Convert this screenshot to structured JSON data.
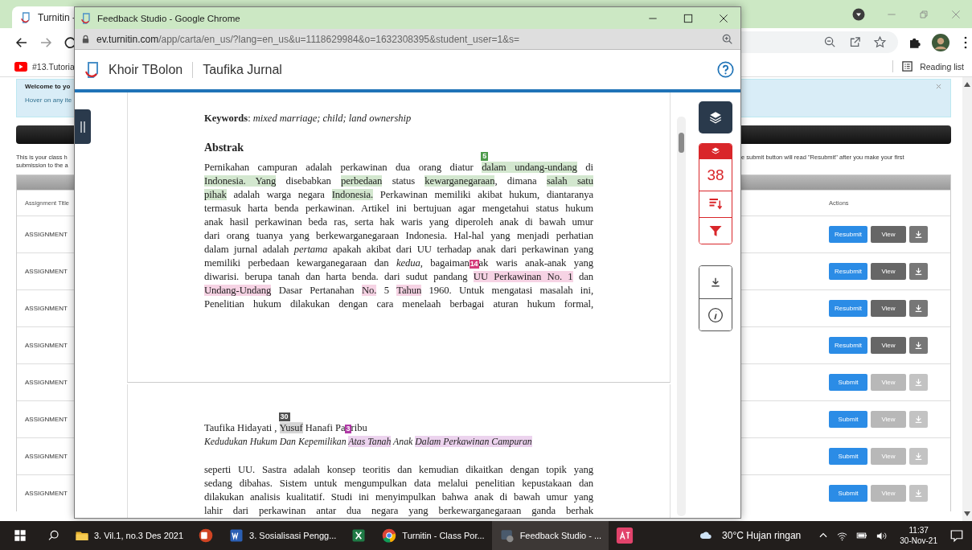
{
  "browser": {
    "tab": {
      "title": "Turnitin -"
    },
    "bookmark": {
      "label": "#13.Tutoria"
    },
    "reading_list": {
      "label": "Reading list"
    },
    "notice": {
      "title": "Welcome to yo",
      "text": "Hover on any ite"
    },
    "intro": {
      "left": [
        "This is your class h",
        "submission to the a"
      ],
      "right": "e submit button will read \"Resubmit\" after you make your first"
    },
    "table": {
      "columns": [
        "Assignment Title",
        "Actions"
      ],
      "rows": [
        {
          "title": "ASSIGNMENT",
          "action": "Resubmit",
          "view": "View",
          "disabled": false
        },
        {
          "title": "ASSIGNMENT",
          "action": "Resubmit",
          "view": "View",
          "disabled": false
        },
        {
          "title": "ASSIGNMENT",
          "action": "Resubmit",
          "view": "View",
          "disabled": false
        },
        {
          "title": "ASSIGNMENT",
          "action": "Resubmit",
          "view": "View",
          "disabled": false
        },
        {
          "title": "ASSIGNMENT",
          "action": "Submit",
          "view": "View",
          "disabled": true
        },
        {
          "title": "ASSIGNMENT",
          "action": "Submit",
          "view": "View",
          "disabled": true
        },
        {
          "title": "ASSIGNMENT",
          "action": "Submit",
          "view": "View",
          "disabled": true
        },
        {
          "title": "ASSIGNMENT",
          "action": "Submit",
          "view": "View",
          "disabled": true
        }
      ]
    }
  },
  "popup": {
    "title": "Feedback Studio - Google Chrome",
    "url": "ev.turnitin.com/app/carta/en_us/?lang=en_us&u=1118629984&o=1632308395&student_user=1&s=",
    "header": {
      "author": "Khoir TBolon",
      "document": "Taufika Jurnal"
    },
    "sidebar": {
      "match_count": "38"
    },
    "pages": [
      {
        "blocks": [
          {
            "kind": "keywords",
            "text": "**Keywords**: *mixed marriage; child; land ownership*"
          },
          {
            "kind": "heading",
            "text": "Abstrak"
          },
          {
            "kind": "justified",
            "lines": [
              [
                {
                  "kind": "text",
                  "text": "Pernikahan campuran adalah perkawinan dua orang diatur "
                },
                {
                  "kind": "match",
                  "text": "dalam undang-undang",
                  "color": "#d3e7cf",
                  "flag": {
                    "text": "5",
                    "color": "#4c9a4a"
                  }
                },
                {
                  "kind": "text",
                  "text": " di"
                }
              ],
              [
                {
                  "kind": "match",
                  "text": "Indonesia. Yang",
                  "color": "#d3e7cf"
                },
                {
                  "kind": "text",
                  "text": " disebabkan "
                },
                {
                  "kind": "match",
                  "text": "perbedaan",
                  "color": "#d3e7cf"
                },
                {
                  "kind": "text",
                  "text": " status "
                },
                {
                  "kind": "match",
                  "text": "kewarganegaraan",
                  "color": "#d3e7cf"
                },
                {
                  "kind": "text",
                  "text": ", dimana "
                },
                {
                  "kind": "match",
                  "text": "salah satu",
                  "color": "#d3e7cf"
                }
              ],
              [
                {
                  "kind": "match",
                  "text": "pihak",
                  "color": "#d3e7cf"
                },
                {
                  "kind": "text",
                  "text": " adalah warga negara "
                },
                {
                  "kind": "match",
                  "text": "Indonesia.",
                  "color": "#d3e7cf"
                },
                {
                  "kind": "text",
                  "text": " Perkawinan memiliki akibat hukum, diantaranya"
                }
              ],
              [
                {
                  "kind": "text",
                  "text": "termasuk harta benda perkawinan. Artikel ini bertujuan agar mengetahui status hukum"
                }
              ],
              [
                {
                  "kind": "text",
                  "text": "anak hasil perkawinan beda ras, serta hak waris yang diperoleh anak di bawah umur"
                }
              ],
              [
                {
                  "kind": "text",
                  "text": "dari orang tuanya yang berkewarganegaraan Indonesia. Hal-hal yang menjadi perhatian"
                }
              ],
              [
                {
                  "kind": "text",
                  "text": "dalam jurnal adalah *pertama* apakah akibat dari UU terhadap anak dari perkawinan yang"
                }
              ],
              [
                {
                  "kind": "text",
                  "text": "memiliki perbedaan kewarganegaraan dan *kedua*, bagaiman"
                },
                {
                  "kind": "marker",
                  "text": "14",
                  "color": "#d43d7b"
                },
                {
                  "kind": "text",
                  "text": "ak waris anak-anak yang"
                }
              ],
              [
                {
                  "kind": "text",
                  "text": "diwarisi. berupa tanah dan harta benda. dari sudut pandang "
                },
                {
                  "kind": "match",
                  "text": "UU Perkawinan No. 1",
                  "color": "#f6d3e4"
                },
                {
                  "kind": "text",
                  "text": " dan"
                }
              ],
              [
                {
                  "kind": "match",
                  "text": "Undang-Undang",
                  "color": "#f6d3e4"
                },
                {
                  "kind": "text",
                  "text": " Dasar Pertanahan "
                },
                {
                  "kind": "match",
                  "text": "No.",
                  "color": "#f6d3e4"
                },
                {
                  "kind": "text",
                  "text": " 5 "
                },
                {
                  "kind": "match",
                  "text": "Tahun",
                  "color": "#f6d3e4"
                },
                {
                  "kind": "text",
                  "text": " 1960. Untuk mengatasi masalah ini,"
                }
              ],
              [
                {
                  "kind": "text",
                  "text": "Penelitian hukum dilakukan dengan cara menelaah berbagai aturan hukum formal,"
                }
              ]
            ]
          }
        ]
      },
      {
        "blocks": [
          {
            "kind": "byline",
            "lines": [
              [
                {
                  "kind": "text",
                  "text": "Taufika Hidayati , "
                },
                {
                  "kind": "match",
                  "text": "Yusuf",
                  "color": "#d6d6d6",
                  "flag": {
                    "text": "30",
                    "color": "#4f4f4f"
                  }
                },
                {
                  "kind": "text",
                  "text": " Hanafi Pa"
                },
                {
                  "kind": "marker",
                  "text": "3",
                  "color": "#b03aa6"
                },
                {
                  "kind": "text",
                  "text": "ribu"
                }
              ]
            ]
          },
          {
            "kind": "subtitle",
            "lines": [
              [
                {
                  "kind": "text",
                  "text": "Kedudukan Hukum Dan Kepemilikan "
                },
                {
                  "kind": "match",
                  "text": "Atas Tanah",
                  "color": "#ecd3ee"
                },
                {
                  "kind": "text",
                  "text": " Anak "
                },
                {
                  "kind": "match",
                  "text": "Dalam Perkawinan Campuran",
                  "color": "#ecd3ee"
                }
              ]
            ]
          },
          {
            "kind": "justified",
            "lines": [
              [
                {
                  "kind": "text",
                  "text": "seperti UU. Sastra adalah konsep teoritis dan kemudian dikaitkan dengan topik yang"
                }
              ],
              [
                {
                  "kind": "text",
                  "text": "sedang dibahas. Sistem untuk mengumpulkan data melalui penelitian kepustakaan dan"
                }
              ],
              [
                {
                  "kind": "text",
                  "text": "dilakukan analisis kualitatif. Studi ini menyimpulkan bahwa anak di bawah umur yang"
                }
              ],
              [
                {
                  "kind": "text",
                  "text": "lahir dari perkawinan antar dua negara yang berkewarganegaraan ganda berhak"
                }
              ]
            ]
          }
        ]
      }
    ]
  },
  "taskbar": {
    "apps": [
      {
        "kind": "folder",
        "label": "3. Vil.1, no.3 Des 2021",
        "selected": false
      },
      {
        "kind": "powerpoint",
        "selected": false
      },
      {
        "kind": "word",
        "label": "3. Sosialisasi Pengg...",
        "selected": false
      },
      {
        "kind": "excel",
        "selected": false
      },
      {
        "kind": "chrome",
        "label": "Turnitin - Class Por...",
        "selected": false
      },
      {
        "kind": "studio",
        "label": "Feedback Studio - ...",
        "selected": true
      },
      {
        "kind": "translate",
        "selected": false
      }
    ],
    "weather": "30°C Hujan ringan",
    "time": "11:37",
    "date": "30-Nov-21"
  }
}
